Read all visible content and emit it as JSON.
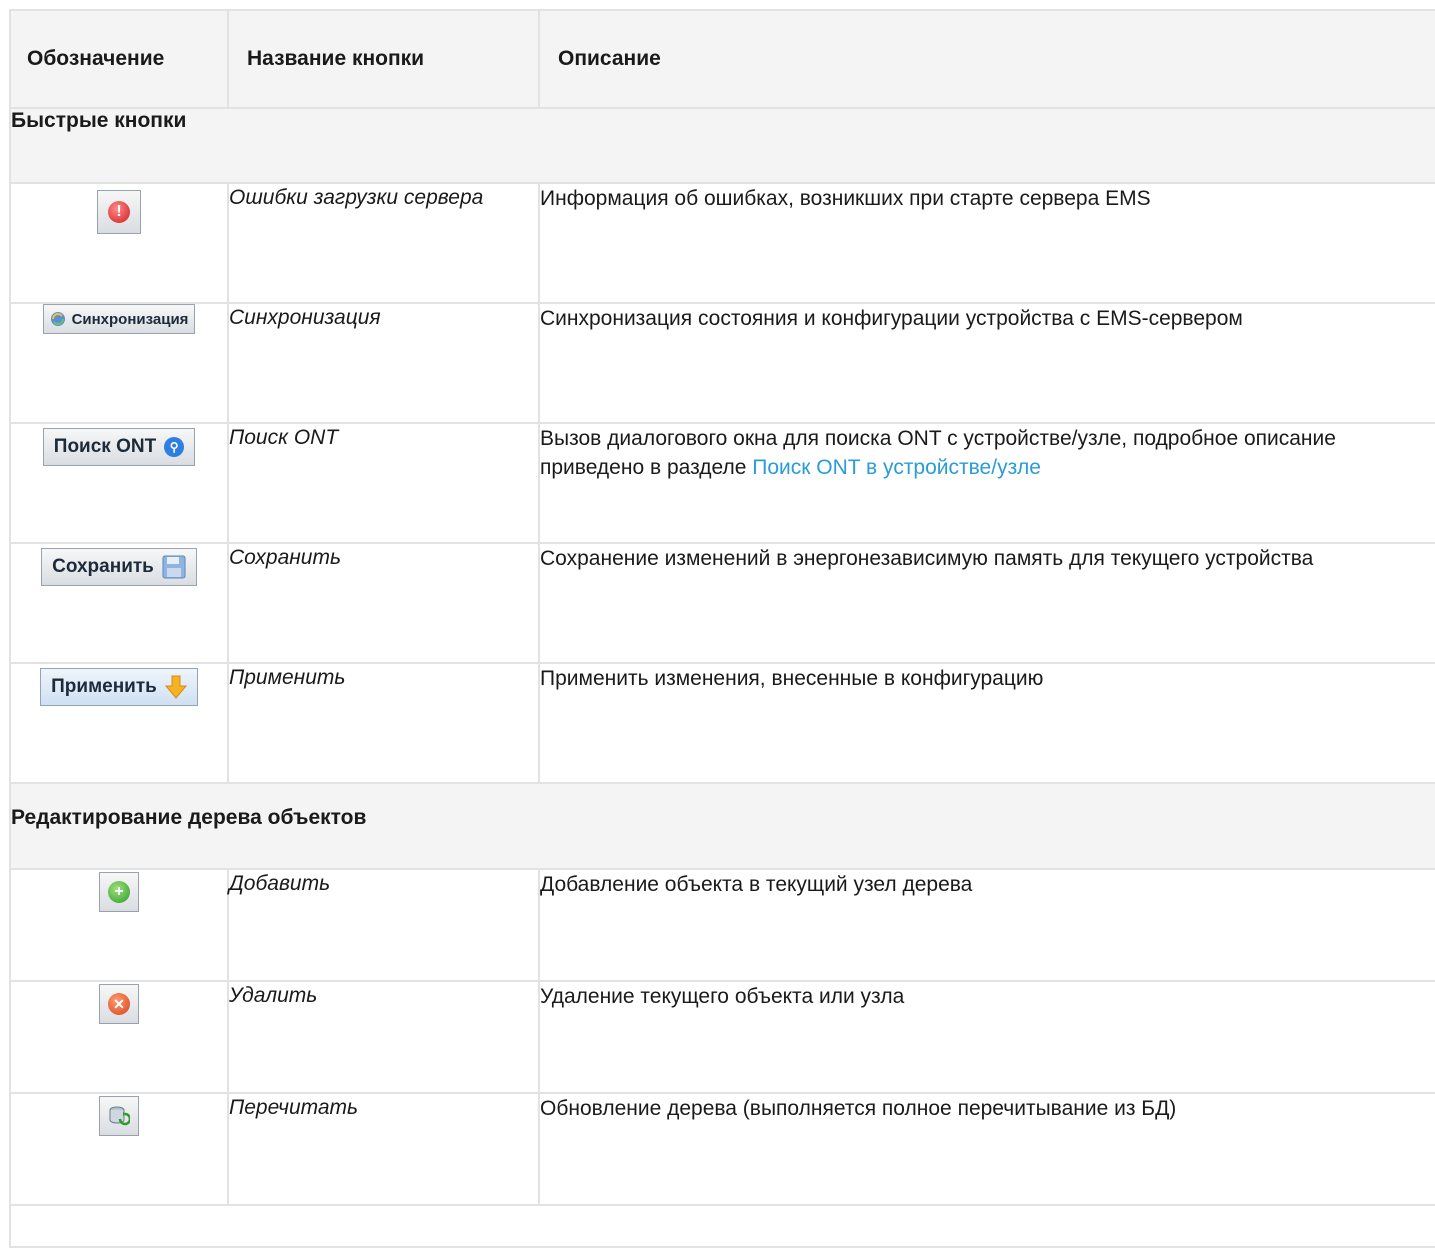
{
  "header": {
    "col1": "Обозначение",
    "col2": "Название кнопки",
    "col3": "Описание"
  },
  "sections": {
    "quick": "Быстрые кнопки",
    "tree": "Редактирование дерева объектов"
  },
  "rows": {
    "errors": {
      "name": "Ошибки загрузки сервера",
      "desc": "Информация об ошибках, возникших при старте сервера EMS",
      "icon": "error-icon"
    },
    "sync": {
      "button_label": "Синхронизация",
      "name": "Синхронизация",
      "desc": "Синхронизация состояния и конфигурации устройства с EMS-сервером",
      "icon": "sync-icon"
    },
    "search": {
      "button_label": "Поиск ONT",
      "name": "Поиск ONT",
      "desc_prefix": "Вызов диалогового окна для поиска ONT с устройстве/узле, подробное описание приведено в разделе ",
      "desc_link": "Поиск ONT в устройстве/узле",
      "icon": "search-icon"
    },
    "save": {
      "button_label": "Сохранить",
      "name": "Сохранить",
      "desc": "Сохранение изменений в энергонезависимую память для текущего устройства",
      "icon": "floppy-icon"
    },
    "apply": {
      "button_label": "Применить",
      "name": "Применить",
      "desc": "Применить изменения, внесенные в конфигурацию",
      "icon": "arrow-down-icon"
    },
    "add": {
      "name": "Добавить",
      "desc": "Добавление объекта в текущий узел дерева",
      "icon": "plus-icon"
    },
    "remove": {
      "name": "Удалить",
      "desc": "Удаление текущего объекта или узла",
      "icon": "delete-icon"
    },
    "reload": {
      "name": "Перечитать",
      "desc": "Обновление дерева (выполняется полное перечитывание из БД)",
      "icon": "database-refresh-icon"
    }
  },
  "colors": {
    "link": "#2a9cd6",
    "header_bg": "#f4f4f4",
    "border": "#e2e2e2"
  }
}
